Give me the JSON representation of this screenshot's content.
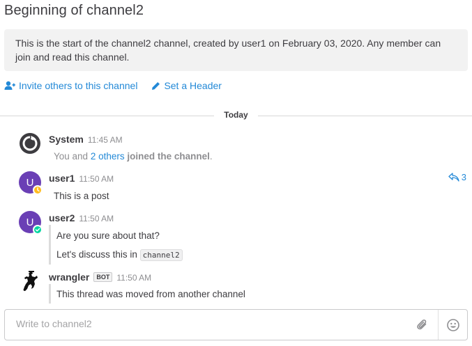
{
  "channel": {
    "title": "Beginning of channel2",
    "intro_text": "This is the start of the channel2 channel, created by user1 on February 03, 2020. Any member can join and read this channel.",
    "invite_label": "Invite others to this channel",
    "header_label": "Set a Header"
  },
  "date_separator": "Today",
  "posts": [
    {
      "username": "System",
      "time": "11:45 AM",
      "body_prefix": "You and ",
      "body_link": "2 others",
      "body_suffix": " joined the channel",
      "body_end": "."
    },
    {
      "username": "user1",
      "avatar_letter": "U",
      "time": "11:50 AM",
      "body": "This is a post",
      "reply_count": "3",
      "status": "away"
    },
    {
      "username": "user2",
      "avatar_letter": "U",
      "time": "11:50 AM",
      "body": "Are you sure about that?",
      "body2_prefix": "Let's discuss this in ",
      "body2_code": "channel2",
      "status": "online"
    },
    {
      "username": "wrangler",
      "badge": "BOT",
      "time": "11:50 AM",
      "body": "This thread was moved from another channel"
    }
  ],
  "composer": {
    "placeholder": "Write to channel2"
  },
  "colors": {
    "link": "#2389d7",
    "avatar": "#6a3fb5",
    "away": "#ffbc1f",
    "online": "#06d6a0"
  }
}
